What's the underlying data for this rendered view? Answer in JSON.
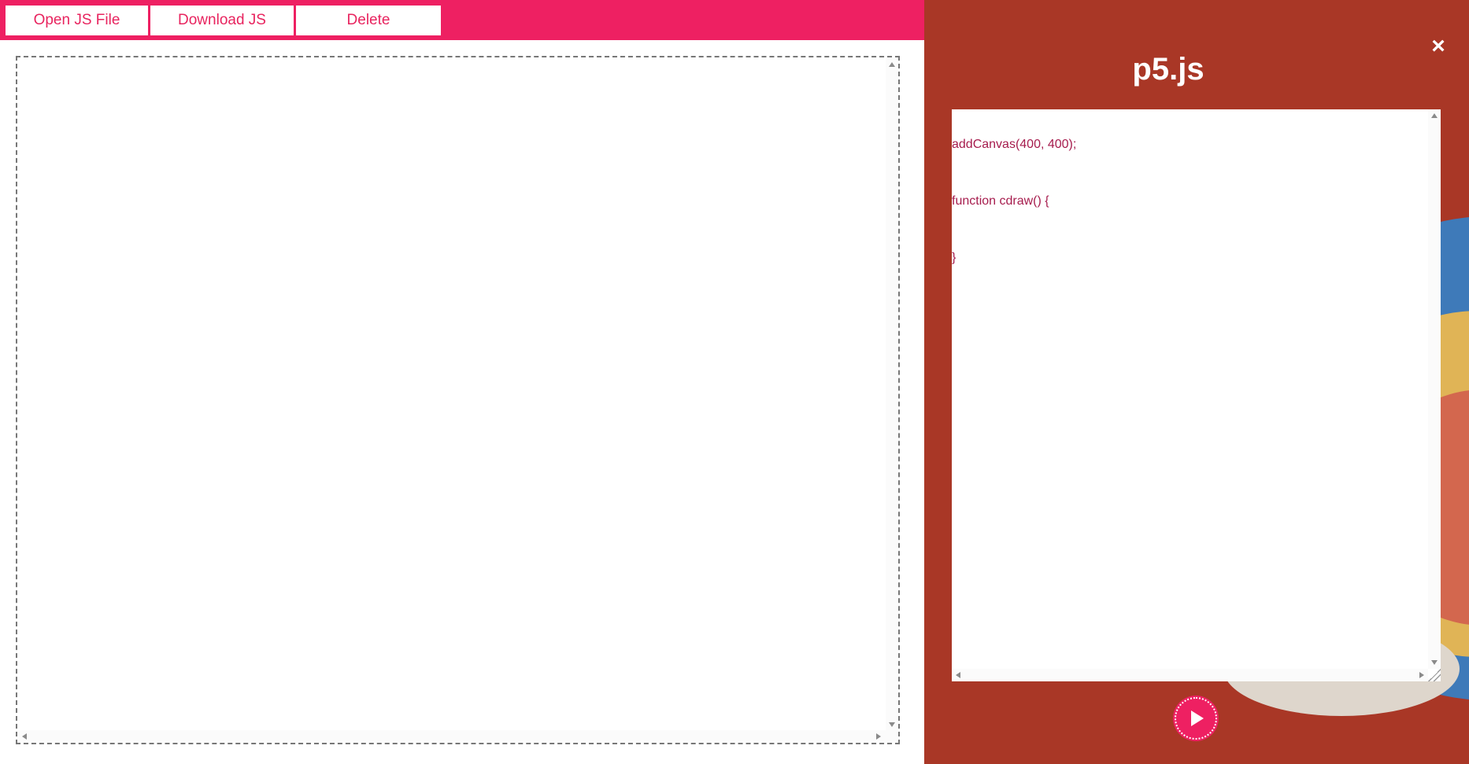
{
  "toolbar": {
    "open_label": "Open JS File",
    "download_label": "Download JS",
    "delete_label": "Delete"
  },
  "panel": {
    "title": "p5.js",
    "close_glyph": "×",
    "code_lines": [
      "addCanvas(400, 400);",
      "function cdraw() {",
      "}"
    ],
    "run_icon": "play-icon"
  },
  "colors": {
    "toolbar_bg": "#ee2062",
    "panel_bg": "#a93726",
    "code_text": "#a61c4d",
    "deco_blue": "#3e7ab9",
    "deco_yellow": "#e0b456",
    "deco_coral": "#d3674e"
  }
}
